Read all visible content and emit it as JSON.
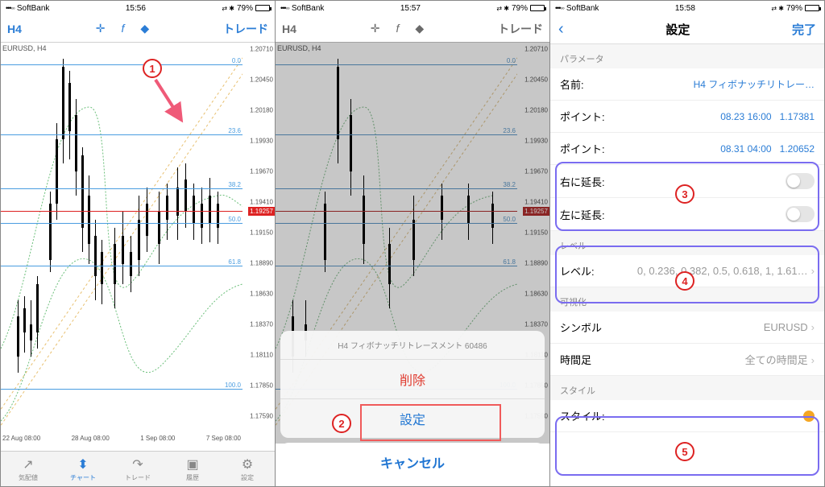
{
  "status": {
    "carrier": "SoftBank",
    "times": [
      "15:56",
      "15:57",
      "15:58"
    ],
    "battery": "79%"
  },
  "topbar": {
    "timeframe": "H4",
    "trade_label": "トレード"
  },
  "chart": {
    "pair_label": "EURUSD, H4",
    "price_tag": "1.19257",
    "y_ticks": [
      "1.20710",
      "1.20450",
      "1.20180",
      "1.19930",
      "1.19670",
      "1.19410",
      "1.19150",
      "1.18890",
      "1.18630",
      "1.18370",
      "1.18110",
      "1.17850",
      "1.17590"
    ],
    "fib_levels": [
      {
        "label": "0.0",
        "pct": 4
      },
      {
        "label": "23.6",
        "pct": 22
      },
      {
        "label": "38.2",
        "pct": 36
      },
      {
        "label": "50.0",
        "pct": 45
      },
      {
        "label": "61.8",
        "pct": 56
      },
      {
        "label": "100.0",
        "pct": 88
      }
    ],
    "x_ticks": [
      "22 Aug 08:00",
      "28 Aug 08:00",
      "1 Sep 08:00",
      "7 Sep 08:00"
    ]
  },
  "bottombar": {
    "items": [
      {
        "icon": "↗",
        "label": "気配値"
      },
      {
        "icon": "⬍",
        "label": "チャート"
      },
      {
        "icon": "↷",
        "label": "トレード"
      },
      {
        "icon": "▣",
        "label": "履歴"
      },
      {
        "icon": "⚙",
        "label": "設定"
      }
    ],
    "active_index": 1
  },
  "actionsheet": {
    "title": "H4 フィボナッチリトレースメント 60486",
    "delete": "削除",
    "settings": "設定",
    "cancel": "キャンセル"
  },
  "settings": {
    "nav_title": "設定",
    "done": "完了",
    "sec_params": "パラメータ",
    "name_label": "名前:",
    "name_value": "H4 フィボナッチリトレー…",
    "point_label": "ポイント:",
    "point1_date": "08.23 16:00",
    "point1_val": "1.17381",
    "point2_date": "08.31 04:00",
    "point2_val": "1.20652",
    "ext_right": "右に延長:",
    "ext_left": "左に延長:",
    "sec_levels": "レベル",
    "levels_label": "レベル:",
    "levels_value": "0, 0.236, 0.382, 0.5, 0.618, 1, 1.61…",
    "sec_vis": "可視化",
    "symbol_label": "シンボル",
    "symbol_value": "EURUSD",
    "tf_label": "時間足",
    "tf_value": "全ての時間足",
    "sec_style": "スタイル",
    "style_label": "スタイル:"
  },
  "annotations": {
    "n1": "1",
    "n2": "2",
    "n3": "3",
    "n4": "4",
    "n5": "5"
  }
}
